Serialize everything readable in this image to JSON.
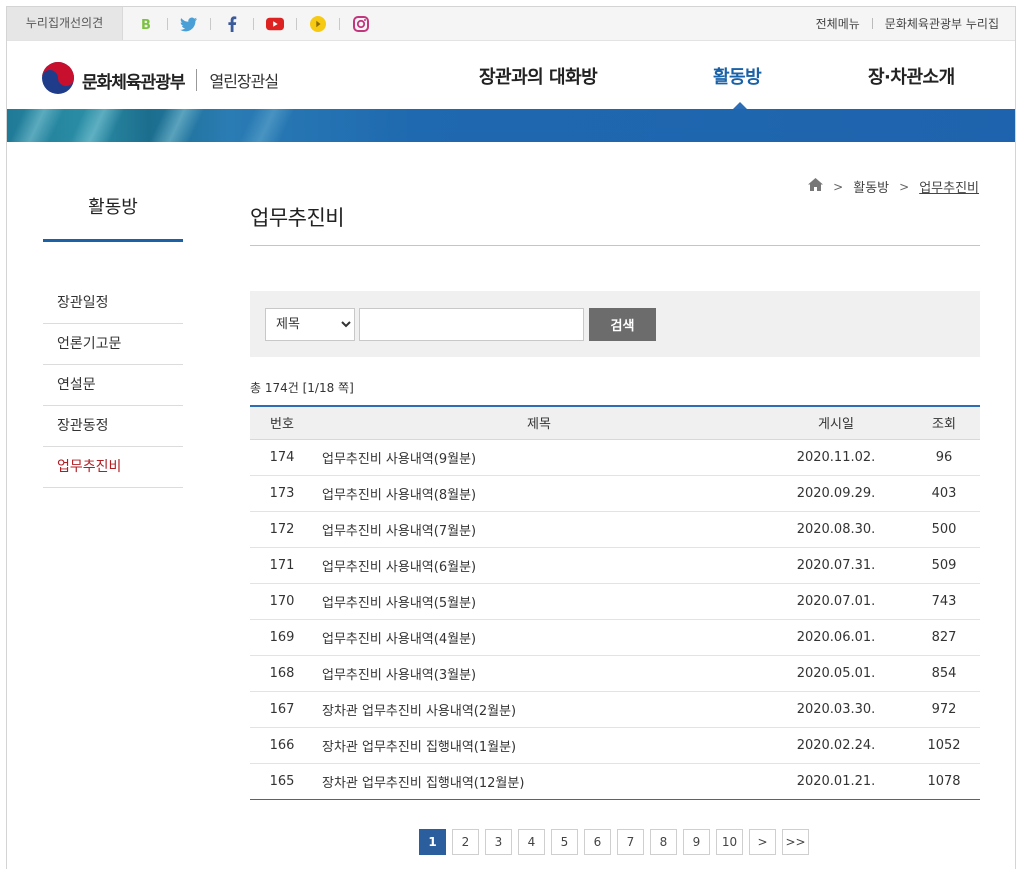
{
  "util": {
    "feedback": "누리집개선의견",
    "social": [
      "blog-icon",
      "twitter-icon",
      "facebook-icon",
      "youtube-icon",
      "kakao-story-icon",
      "instagram-icon"
    ],
    "links": [
      "전체메뉴",
      "문화체육관광부 누리집"
    ]
  },
  "header": {
    "logo_name": "문화체육관광부",
    "logo_sub": "열린장관실",
    "gnb": [
      "장관과의 대화방",
      "활동방",
      "장·차관소개"
    ],
    "active_gnb": "활동방"
  },
  "lnb": {
    "title": "활동방",
    "items": [
      "장관일정",
      "언론기고문",
      "연설문",
      "장관동정",
      "업무추진비"
    ],
    "active": "업무추진비"
  },
  "breadcrumb": [
    "활동방",
    "업무추진비"
  ],
  "page_title": "업무추진비",
  "search": {
    "select_value": "제목",
    "input_value": "",
    "button_label": "검색"
  },
  "count_text": "총 174건 [1/18 쪽]",
  "table": {
    "headers": [
      "번호",
      "제목",
      "게시일",
      "조회"
    ],
    "rows": [
      [
        "174",
        "업무추진비 사용내역(9월분)",
        "2020.11.02.",
        "96"
      ],
      [
        "173",
        "업무추진비 사용내역(8월분)",
        "2020.09.29.",
        "403"
      ],
      [
        "172",
        "업무추진비 사용내역(7월분)",
        "2020.08.30.",
        "500"
      ],
      [
        "171",
        "업무추진비 사용내역(6월분)",
        "2020.07.31.",
        "509"
      ],
      [
        "170",
        "업무추진비 사용내역(5월분)",
        "2020.07.01.",
        "743"
      ],
      [
        "169",
        "업무추진비 사용내역(4월분)",
        "2020.06.01.",
        "827"
      ],
      [
        "168",
        "업무추진비 사용내역(3월분)",
        "2020.05.01.",
        "854"
      ],
      [
        "167",
        "장차관 업무추진비 사용내역(2월분)",
        "2020.03.30.",
        "972"
      ],
      [
        "166",
        "장차관 업무추진비 집행내역(1월분)",
        "2020.02.24.",
        "1052"
      ],
      [
        "165",
        "장차관 업무추진비 집행내역(12월분)",
        "2020.01.21.",
        "1078"
      ]
    ]
  },
  "paging": {
    "pages": [
      "1",
      "2",
      "3",
      "4",
      "5",
      "6",
      "7",
      "8",
      "9",
      "10"
    ],
    "current": "1",
    "next": ">",
    "last": ">>"
  },
  "colors": {
    "accent": "#1a62a8",
    "active_lnb": "#b11e22",
    "search_button": "#6c6c6c",
    "current_page": "#2a5e9c"
  }
}
